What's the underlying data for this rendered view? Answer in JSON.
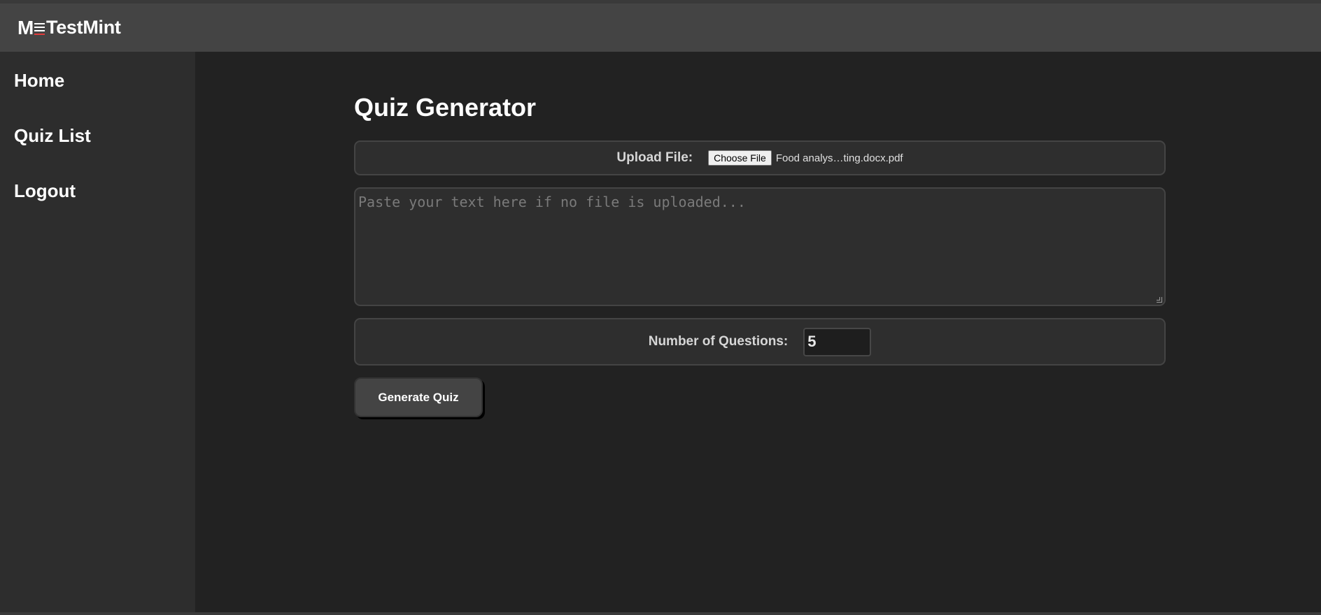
{
  "app": {
    "logo_mark": "M",
    "logo_text": "TestMint"
  },
  "sidebar": {
    "items": [
      {
        "label": "Home"
      },
      {
        "label": "Quiz List"
      },
      {
        "label": "Logout"
      }
    ]
  },
  "main": {
    "title": "Quiz Generator",
    "upload": {
      "label": "Upload File:",
      "button_label": "Choose File",
      "file_name": "Food analys…ting.docx.pdf"
    },
    "text_area": {
      "placeholder": "Paste your text here if no file is uploaded..."
    },
    "questions": {
      "label": "Number of Questions:",
      "value": "5"
    },
    "generate_button_label": "Generate Quiz"
  },
  "colors": {
    "header_bg": "#444444",
    "sidebar_bg": "#2d2d2d",
    "main_bg": "#222222",
    "panel_bg": "#2e2e2e",
    "logo_accent": "#e23c3c"
  }
}
